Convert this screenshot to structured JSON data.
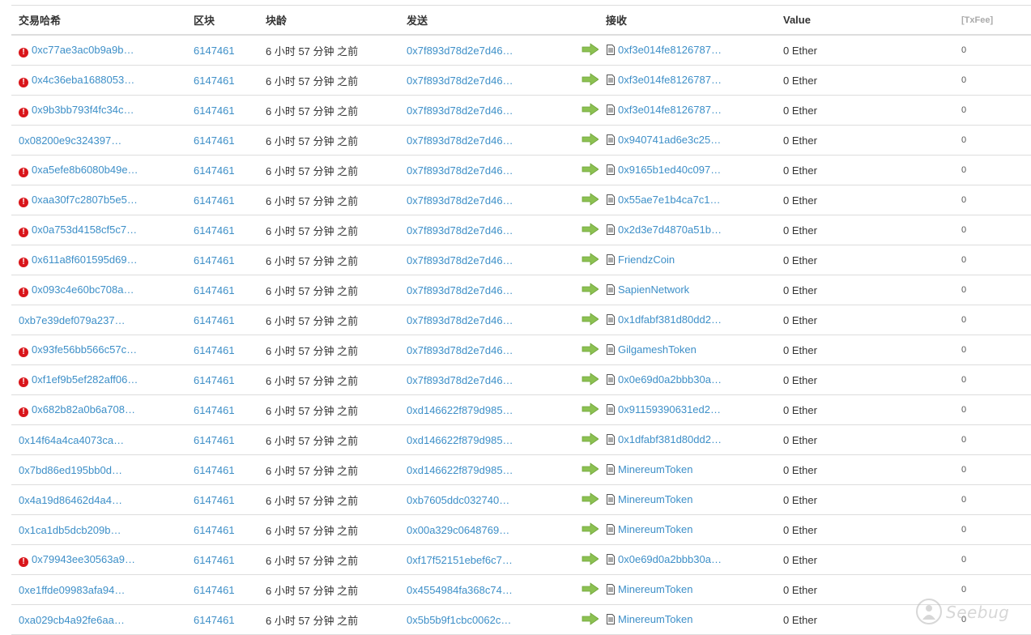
{
  "columns": {
    "hash": "交易哈希",
    "block": "区块",
    "age": "块龄",
    "from": "发送",
    "to": "接收",
    "value": "Value",
    "fee": "[TxFee]"
  },
  "rows": [
    {
      "error": true,
      "hash": "0xc77ae3ac0b9a9b…",
      "block": "6147461",
      "age": "6 小时 57 分钟 之前",
      "from": "0x7f893d78d2e7d46…",
      "to": "0xf3e014fe8126787…",
      "value": "0 Ether",
      "fee": "0"
    },
    {
      "error": true,
      "hash": "0x4c36eba1688053…",
      "block": "6147461",
      "age": "6 小时 57 分钟 之前",
      "from": "0x7f893d78d2e7d46…",
      "to": "0xf3e014fe8126787…",
      "value": "0 Ether",
      "fee": "0"
    },
    {
      "error": true,
      "hash": "0x9b3bb793f4fc34c…",
      "block": "6147461",
      "age": "6 小时 57 分钟 之前",
      "from": "0x7f893d78d2e7d46…",
      "to": "0xf3e014fe8126787…",
      "value": "0 Ether",
      "fee": "0"
    },
    {
      "error": false,
      "hash": "0x08200e9c324397…",
      "block": "6147461",
      "age": "6 小时 57 分钟 之前",
      "from": "0x7f893d78d2e7d46…",
      "to": "0x940741ad6e3c25…",
      "value": "0 Ether",
      "fee": "0"
    },
    {
      "error": true,
      "hash": "0xa5efe8b6080b49e…",
      "block": "6147461",
      "age": "6 小时 57 分钟 之前",
      "from": "0x7f893d78d2e7d46…",
      "to": "0x9165b1ed40c097…",
      "value": "0 Ether",
      "fee": "0"
    },
    {
      "error": true,
      "hash": "0xaa30f7c2807b5e5…",
      "block": "6147461",
      "age": "6 小时 57 分钟 之前",
      "from": "0x7f893d78d2e7d46…",
      "to": "0x55ae7e1b4ca7c1…",
      "value": "0 Ether",
      "fee": "0"
    },
    {
      "error": true,
      "hash": "0x0a753d4158cf5c7…",
      "block": "6147461",
      "age": "6 小时 57 分钟 之前",
      "from": "0x7f893d78d2e7d46…",
      "to": "0x2d3e7d4870a51b…",
      "value": "0 Ether",
      "fee": "0"
    },
    {
      "error": true,
      "hash": "0x611a8f601595d69…",
      "block": "6147461",
      "age": "6 小时 57 分钟 之前",
      "from": "0x7f893d78d2e7d46…",
      "to": "FriendzCoin",
      "value": "0 Ether",
      "fee": "0"
    },
    {
      "error": true,
      "hash": "0x093c4e60bc708a…",
      "block": "6147461",
      "age": "6 小时 57 分钟 之前",
      "from": "0x7f893d78d2e7d46…",
      "to": "SapienNetwork",
      "value": "0 Ether",
      "fee": "0"
    },
    {
      "error": false,
      "hash": "0xb7e39def079a237…",
      "block": "6147461",
      "age": "6 小时 57 分钟 之前",
      "from": "0x7f893d78d2e7d46…",
      "to": "0x1dfabf381d80dd2…",
      "value": "0 Ether",
      "fee": "0"
    },
    {
      "error": true,
      "hash": "0x93fe56bb566c57c…",
      "block": "6147461",
      "age": "6 小时 57 分钟 之前",
      "from": "0x7f893d78d2e7d46…",
      "to": "GilgameshToken",
      "value": "0 Ether",
      "fee": "0"
    },
    {
      "error": true,
      "hash": "0xf1ef9b5ef282aff06…",
      "block": "6147461",
      "age": "6 小时 57 分钟 之前",
      "from": "0x7f893d78d2e7d46…",
      "to": "0x0e69d0a2bbb30a…",
      "value": "0 Ether",
      "fee": "0"
    },
    {
      "error": true,
      "hash": "0x682b82a0b6a708…",
      "block": "6147461",
      "age": "6 小时 57 分钟 之前",
      "from": "0xd146622f879d985…",
      "to": "0x91159390631ed2…",
      "value": "0 Ether",
      "fee": "0"
    },
    {
      "error": false,
      "hash": "0x14f64a4ca4073ca…",
      "block": "6147461",
      "age": "6 小时 57 分钟 之前",
      "from": "0xd146622f879d985…",
      "to": "0x1dfabf381d80dd2…",
      "value": "0 Ether",
      "fee": "0"
    },
    {
      "error": false,
      "hash": "0x7bd86ed195bb0d…",
      "block": "6147461",
      "age": "6 小时 57 分钟 之前",
      "from": "0xd146622f879d985…",
      "to": "MinereumToken",
      "value": "0 Ether",
      "fee": "0"
    },
    {
      "error": false,
      "hash": "0x4a19d86462d4a4…",
      "block": "6147461",
      "age": "6 小时 57 分钟 之前",
      "from": "0xb7605ddc032740…",
      "to": "MinereumToken",
      "value": "0 Ether",
      "fee": "0"
    },
    {
      "error": false,
      "hash": "0x1ca1db5dcb209b…",
      "block": "6147461",
      "age": "6 小时 57 分钟 之前",
      "from": "0x00a329c0648769…",
      "to": "MinereumToken",
      "value": "0 Ether",
      "fee": "0"
    },
    {
      "error": true,
      "hash": "0x79943ee30563a9…",
      "block": "6147461",
      "age": "6 小时 57 分钟 之前",
      "from": "0xf17f52151ebef6c7…",
      "to": "0x0e69d0a2bbb30a…",
      "value": "0 Ether",
      "fee": "0"
    },
    {
      "error": false,
      "hash": "0xe1ffde09983afa94…",
      "block": "6147461",
      "age": "6 小时 57 分钟 之前",
      "from": "0x4554984fa368c74…",
      "to": "MinereumToken",
      "value": "0 Ether",
      "fee": "0"
    },
    {
      "error": false,
      "hash": "0xa029cb4a92fe6aa…",
      "block": "6147461",
      "age": "6 小时 57 分钟 之前",
      "from": "0x5b5b9f1cbc0062c…",
      "to": "MinereumToken",
      "value": "0 Ether",
      "fee": "0"
    }
  ],
  "icons": {
    "error": "error-icon",
    "direction": "arrow-right-icon",
    "contract": "contract-doc-icon"
  },
  "colors": {
    "link": "#3d8fc8",
    "error": "#d9161b",
    "arrow": "#8cc152"
  },
  "watermark": "Seebug"
}
